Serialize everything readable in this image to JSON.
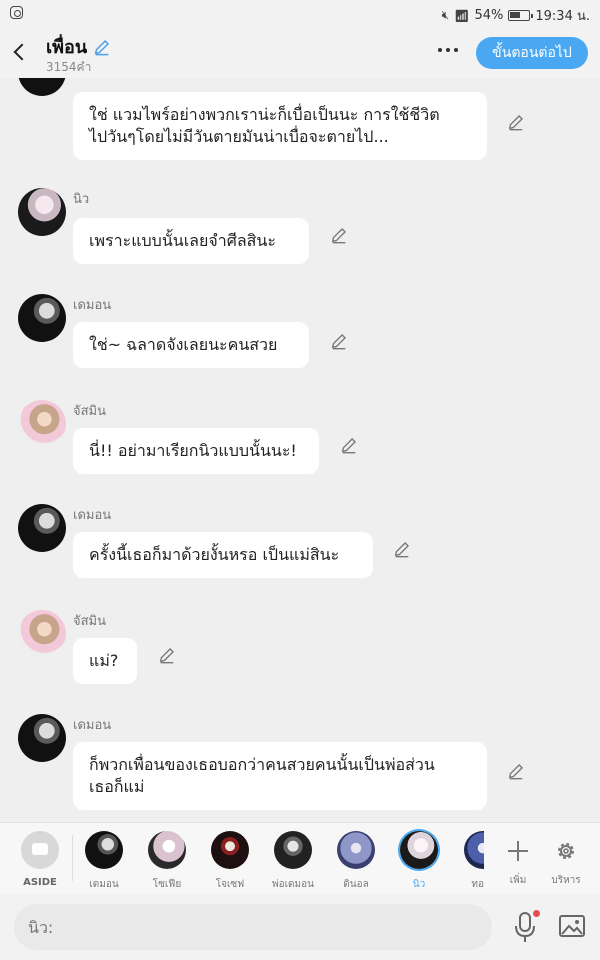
{
  "status_bar": {
    "battery": "54%",
    "time": "19:34 น."
  },
  "header": {
    "title": "เพื่อน",
    "subtitle": "3154คำ",
    "next_button": "ขั้นตอนต่อไป"
  },
  "messages": [
    {
      "name": "",
      "avatar": "demon",
      "lines": [
        "ใช่ แวมไพร์อย่างพวกเราน่ะก็เบื่อเป็นนะ การใช้ชีวิต",
        "ไปวันๆโดยไม่มีวันตายมันน่าเบื่อจะตายไป..."
      ]
    },
    {
      "name": "นิว",
      "avatar": "niw",
      "lines": [
        "เพราะแบบนั้นเลยจำศีลสินะ"
      ]
    },
    {
      "name": "เดมอน",
      "avatar": "demon",
      "lines": [
        "ใช่~ ฉลาดจังเลยนะคนสวย"
      ]
    },
    {
      "name": "จัสมิน",
      "avatar": "jas",
      "lines": [
        "นี่!! อย่ามาเรียกนิวแบบนั้นนะ!"
      ]
    },
    {
      "name": "เดมอน",
      "avatar": "demon",
      "lines": [
        "ครั้งนี้เธอก็มาด้วยงั้นหรอ เป็นแม่สินะ"
      ]
    },
    {
      "name": "จัสมิน",
      "avatar": "jas",
      "lines": [
        "แม่?"
      ]
    },
    {
      "name": "เดมอน",
      "avatar": "demon",
      "lines": [
        "ก็พวกเพื่อนของเธอบอกว่าคนสวยคนนั้นเป็นพ่อส่วน",
        "เธอก็แม่"
      ]
    }
  ],
  "cast_bar": {
    "aside_label": "ASIDE",
    "cast": [
      {
        "label": "เดมอน",
        "color": "#1b1b1b"
      },
      {
        "label": "โซเฟีย",
        "color": "#d9c3cf"
      },
      {
        "label": "โจเซฟ",
        "color": "#3a1414"
      },
      {
        "label": "พ่อเดมอน",
        "color": "#2a2a2a"
      },
      {
        "label": "ดินอล",
        "color": "#8f96c8"
      },
      {
        "label": "นิว",
        "color": "#e9e0e6"
      },
      {
        "label": "ทอ",
        "color": "#4c5fa8"
      }
    ],
    "add_label": "เพิ่ม",
    "manage_label": "บริหาร"
  },
  "input": {
    "placeholder": "นิว:"
  },
  "colors": {
    "accent": "#4aa7f2",
    "background": "#efefef",
    "bubble": "#ffffff"
  }
}
